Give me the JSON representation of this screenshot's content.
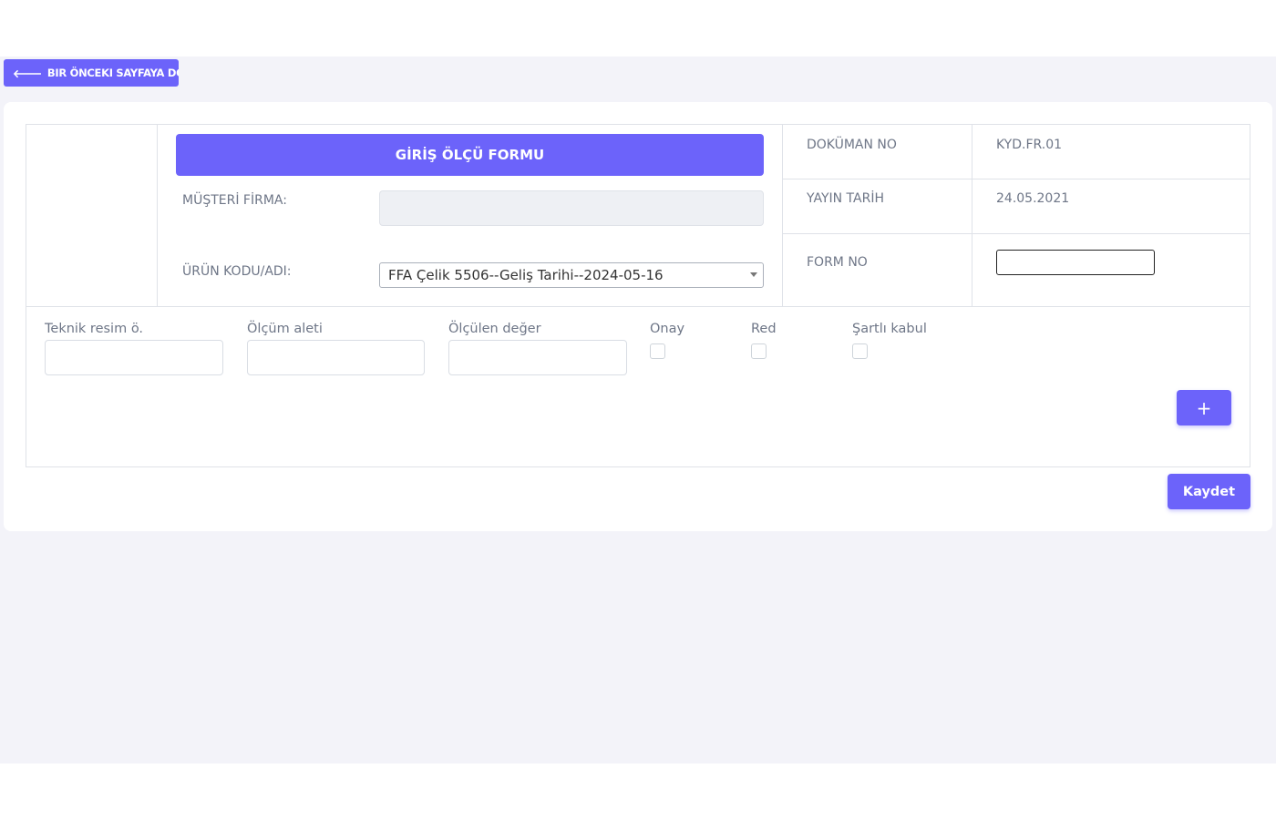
{
  "nav": {
    "back_label": "BIR ÖNCEKI SAYFAYA DÖN"
  },
  "header": {
    "form_title": "GİRİŞ ÖLÇÜ FORMU",
    "musteri_label": "MÜŞTERİ FİRMA:",
    "musteri_value": "",
    "urun_label": "ÜRÜN KODU/ADI:",
    "urun_selected": "FFA Çelik 5506--Geliş Tarihi--2024-05-16",
    "doc_no_label": "DOKÜMAN NO",
    "doc_no_value": "KYD.FR.01",
    "yayin_label": "YAYIN TARİH",
    "yayin_value": "24.05.2021",
    "form_no_label": "FORM NO",
    "form_no_value": ""
  },
  "row_fields": {
    "teknik_label": "Teknik resim ö.",
    "olcum_aleti_label": "Ölçüm aleti",
    "olculen_label": "Ölçülen değer",
    "onay_label": "Onay",
    "red_label": "Red",
    "sartli_label": "Şartlı kabul"
  },
  "actions": {
    "add_label": "+",
    "save_label": "Kaydet"
  },
  "colors": {
    "accent": "#6c63fa",
    "page_bg": "#f3f3f9",
    "label_text": "#6e7687"
  }
}
